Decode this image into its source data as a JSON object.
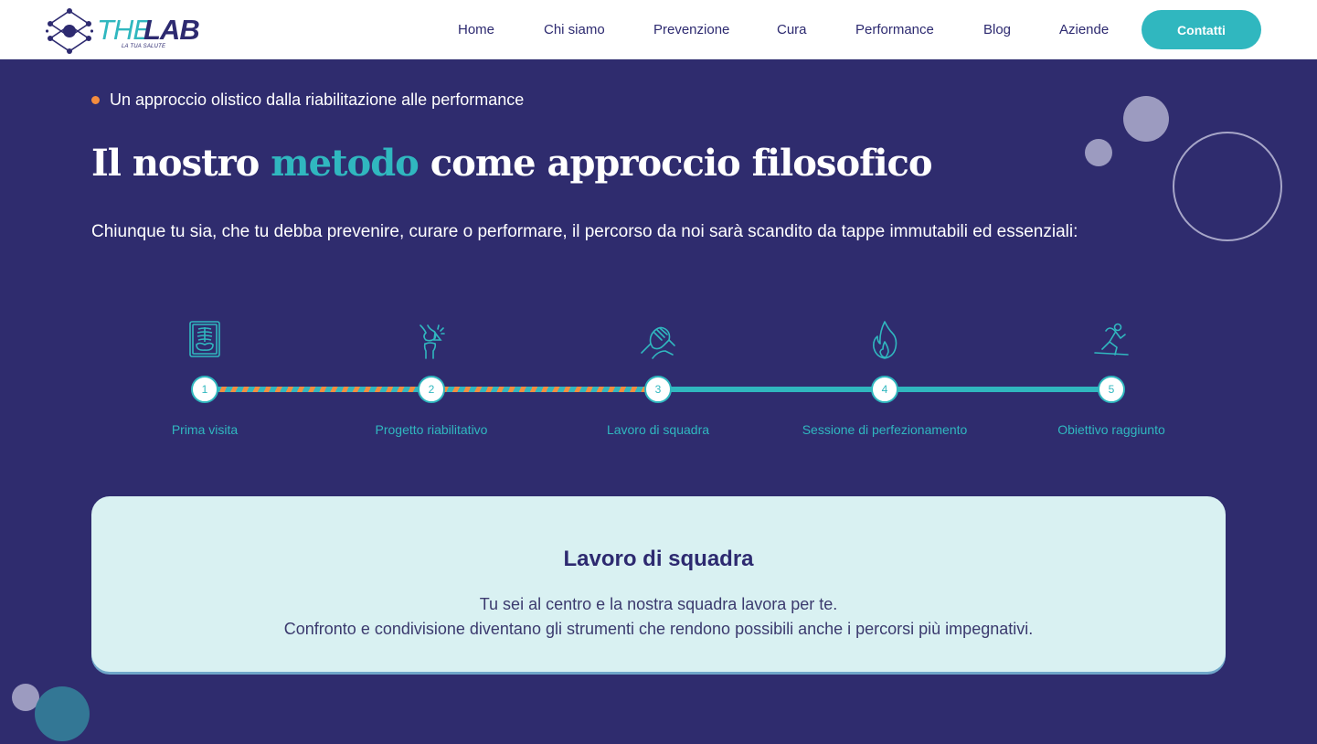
{
  "header": {
    "logo": {
      "the": "THE",
      "lab": "LAB",
      "tagline": "LA TUA SALUTE"
    },
    "nav": [
      {
        "label": "Home"
      },
      {
        "label": "Chi siamo"
      },
      {
        "label": "Prevenzione"
      },
      {
        "label": "Cura"
      },
      {
        "label": "Performance"
      },
      {
        "label": "Blog"
      },
      {
        "label": "Aziende"
      }
    ],
    "cta_label": "Contatti"
  },
  "hero": {
    "eyebrow": "Un approccio olistico dalla riabilitazione alle performance",
    "title_before": "Il nostro ",
    "title_accent": "metodo",
    "title_after": " come approccio filosofico",
    "intro": "Chiunque tu sia, che tu debba prevenire, curare o performare, il percorso da noi sarà scandito da tappe immutabili ed essenziali:"
  },
  "timeline": {
    "active_step": 3,
    "steps": [
      {
        "number": "1",
        "label": "Prima visita",
        "icon": "xray-icon"
      },
      {
        "number": "2",
        "label": "Progetto riabilitativo",
        "icon": "knee-joint-icon"
      },
      {
        "number": "3",
        "label": "Lavoro di squadra",
        "icon": "handshake-icon"
      },
      {
        "number": "4",
        "label": "Sessione di perfezionamento",
        "icon": "flame-icon"
      },
      {
        "number": "5",
        "label": "Obiettivo raggiunto",
        "icon": "runner-icon"
      }
    ]
  },
  "card": {
    "title": "Lavoro di squadra",
    "line1": "Tu sei al centro e la nostra squadra lavora per te.",
    "line2": "Confronto e condivisione diventano gli strumenti che rendono possibili anche i percorsi più impegnativi."
  },
  "colors": {
    "brand_navy": "#2f2c6e",
    "accent_teal": "#30b7bf",
    "accent_orange": "#f58d3e",
    "card_bg": "#d9f1f2"
  }
}
